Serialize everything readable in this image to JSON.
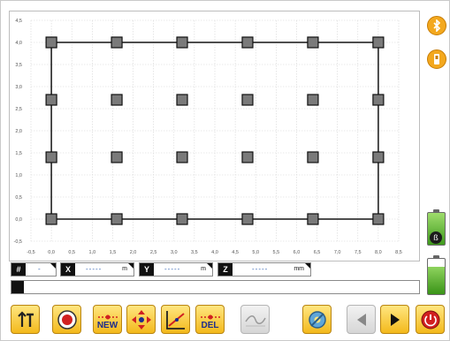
{
  "plot": {
    "y_ticks": [
      "4,5",
      "4,0",
      "3,5",
      "3,0",
      "2,5",
      "2,0",
      "1,5",
      "1,0",
      "0,5",
      "0,0",
      "-0,5"
    ],
    "x_ticks": [
      "-0,5",
      "0,0",
      "0,5",
      "1,0",
      "1,5",
      "2,0",
      "2,5",
      "3,0",
      "3,5",
      "4,0",
      "4,5",
      "5,0",
      "5,5",
      "6,0",
      "6,5",
      "7,0",
      "7,5",
      "8,0",
      "8,5"
    ],
    "y_range": [
      -0.5,
      4.5
    ],
    "x_range": [
      -0.5,
      8.5
    ],
    "grid": true,
    "rectangle": {
      "x_min": 0.0,
      "x_max": 8.0,
      "y_min": 0.0,
      "y_max": 4.0
    },
    "points": [
      {
        "x": 0.0,
        "y": 4.0
      },
      {
        "x": 1.6,
        "y": 4.0
      },
      {
        "x": 3.2,
        "y": 4.0
      },
      {
        "x": 4.8,
        "y": 4.0
      },
      {
        "x": 6.4,
        "y": 4.0
      },
      {
        "x": 8.0,
        "y": 4.0
      },
      {
        "x": 0.0,
        "y": 2.7
      },
      {
        "x": 1.6,
        "y": 2.7
      },
      {
        "x": 3.2,
        "y": 2.7
      },
      {
        "x": 4.8,
        "y": 2.7
      },
      {
        "x": 6.4,
        "y": 2.7
      },
      {
        "x": 8.0,
        "y": 2.7
      },
      {
        "x": 0.0,
        "y": 1.4
      },
      {
        "x": 1.6,
        "y": 1.4
      },
      {
        "x": 3.2,
        "y": 1.4
      },
      {
        "x": 4.8,
        "y": 1.4
      },
      {
        "x": 6.4,
        "y": 1.4
      },
      {
        "x": 8.0,
        "y": 1.4
      },
      {
        "x": 0.0,
        "y": 0.0
      },
      {
        "x": 1.6,
        "y": 0.0
      },
      {
        "x": 3.2,
        "y": 0.0
      },
      {
        "x": 4.8,
        "y": 0.0
      },
      {
        "x": 6.4,
        "y": 0.0
      },
      {
        "x": 8.0,
        "y": 0.0
      }
    ]
  },
  "coords": {
    "index": {
      "tag": "#",
      "value": "-"
    },
    "x": {
      "tag": "X",
      "value": "-----",
      "unit": "m"
    },
    "y": {
      "tag": "Y",
      "value": "-----",
      "unit": "m"
    },
    "z": {
      "tag": "Z",
      "value": "-----",
      "unit": "mm"
    }
  },
  "toolbar": {
    "new_label": "NEW",
    "del_label": "DEL",
    "icons": [
      "set-height-icon",
      "record-icon",
      "new-point-icon",
      "move-point-icon",
      "slope-icon",
      "delete-point-icon",
      "profile-icon",
      "settings-icon",
      "previous-icon",
      "next-icon",
      "power-icon"
    ]
  },
  "status": {
    "battery_1_level": 1.0,
    "battery_2_level": 0.78,
    "colors": {
      "accent": "#f3b91c",
      "battery": "#3f9a1c",
      "text_blue": "#1b2c8d"
    }
  }
}
